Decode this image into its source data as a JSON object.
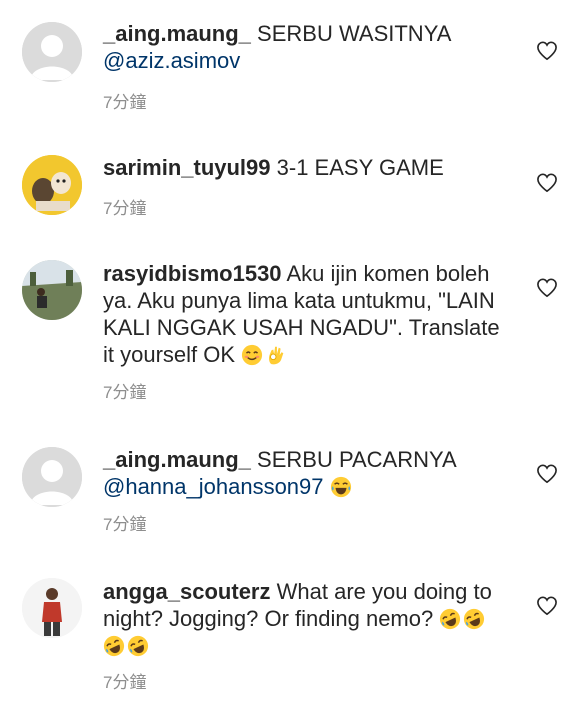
{
  "comments": [
    {
      "username": "_aing.maung_",
      "text": "SERBU WASITNYA",
      "mention": "@aziz.asimov",
      "time": "7分鐘",
      "avatar": "default-avatar"
    },
    {
      "username": "sarimin_tuyul99",
      "text": "3-1 EASY GAME",
      "time": "7分鐘",
      "avatar": "cartoon-avatar"
    },
    {
      "username": "rasyidbismo1530",
      "text_line1": "Aku ijin komen boleh",
      "text_line2": "ya. Aku punya lima kata untukmu, \"LAIN",
      "text_line3": "KALI NGGAK USAH NGADU\". Translate",
      "text_line4": "it yourself OK",
      "emojis": [
        "smiling-face-emoji",
        "ok-hand-emoji"
      ],
      "time": "7分鐘",
      "avatar": "photo-avatar"
    },
    {
      "username": "_aing.maung_",
      "text": "SERBU PACARNYA",
      "mention": "@hanna_johansson97",
      "emojis": [
        "tears-of-joy-emoji"
      ],
      "time": "7分鐘",
      "avatar": "default-avatar"
    },
    {
      "username": "angga_scouterz",
      "text_line1": "What are you doing to",
      "text_line2": "night? Jogging? Or finding nemo?",
      "emojis": [
        "rolling-laughing-emoji",
        "rolling-laughing-emoji",
        "rolling-laughing-emoji",
        "rolling-laughing-emoji"
      ],
      "time": "7分鐘",
      "avatar": "photo-avatar"
    }
  ],
  "colors": {
    "text": "#262626",
    "mention": "#003569",
    "meta": "#8e8e8e"
  }
}
